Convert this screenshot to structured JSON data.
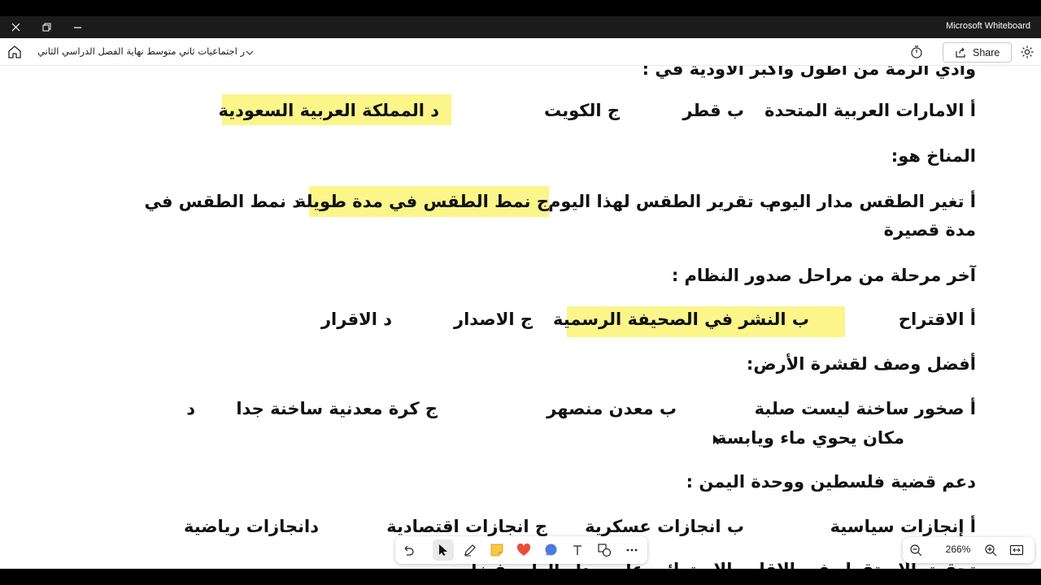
{
  "window": {
    "app_title": "Microsoft Whiteboard",
    "close_icon": "close-icon",
    "restore_icon": "restore-icon",
    "minimize_icon": "minimize-icon"
  },
  "toolbar": {
    "doc_title": "ر اجتماعيات ثاني متوسط نهاية الفصل الدراسي الثاني",
    "share_label": "Share"
  },
  "content": {
    "q1_partial": "وادي الرمة من أطول وأكبر الأودية في :",
    "q1_a": "أ الامارات العربية المتحدة",
    "q1_b": "ب قطر",
    "q1_c": "ج الكويت",
    "q1_d": "د المملكة العربية السعودية",
    "q2": "المناخ هو:",
    "q2_a": "أ تغير الطقس مدار اليوم",
    "q2_b": "ب تقرير الطقس لهذا اليوم",
    "q2_c": "ج نمط الطقس في مدة طويلة",
    "q2_d": "د نمط الطقس في",
    "q2_d_cont": "مدة قصيرة",
    "q3": "آخر مرحلة من مراحل صدور النظام :",
    "q3_a": "أ الاقتراح",
    "q3_b": "ب النشر في الصحيفة الرسمية",
    "q3_c": "ج الاصدار",
    "q3_d": "د الاقرار",
    "q4": "أفضل وصف لقشرة الأرض:",
    "q4_a": "أ صخور ساخنة ليست صلبة",
    "q4_b": "ب معدن منصهر",
    "q4_c": "ج كرة معدنية ساخنة جدا",
    "q4_d": "د",
    "q4_d_cont": "مكان يحوي ماء ويابسة",
    "q5": "دعم قضية فلسطين ووحدة اليمن :",
    "q5_a": "أ إنجازات سياسية",
    "q5_b": "ب انجازات عسكرية",
    "q5_c": "ج انجازات اقتصادية",
    "q5_d": "دانجازات رياضية",
    "q6_partial": "تحقيق الاستقرار في الإقليم الاستوائي على مدار العام بفضل"
  },
  "colors": {
    "highlight": "#fbf58a",
    "titlebar": "#1b1b1b"
  },
  "tools": [
    "undo-icon",
    "select-icon",
    "pen-icon",
    "sticky-note-icon",
    "reaction-icon",
    "comment-icon",
    "text-icon",
    "shapes-icon",
    "more-icon"
  ],
  "zoom": {
    "value": "266%"
  }
}
